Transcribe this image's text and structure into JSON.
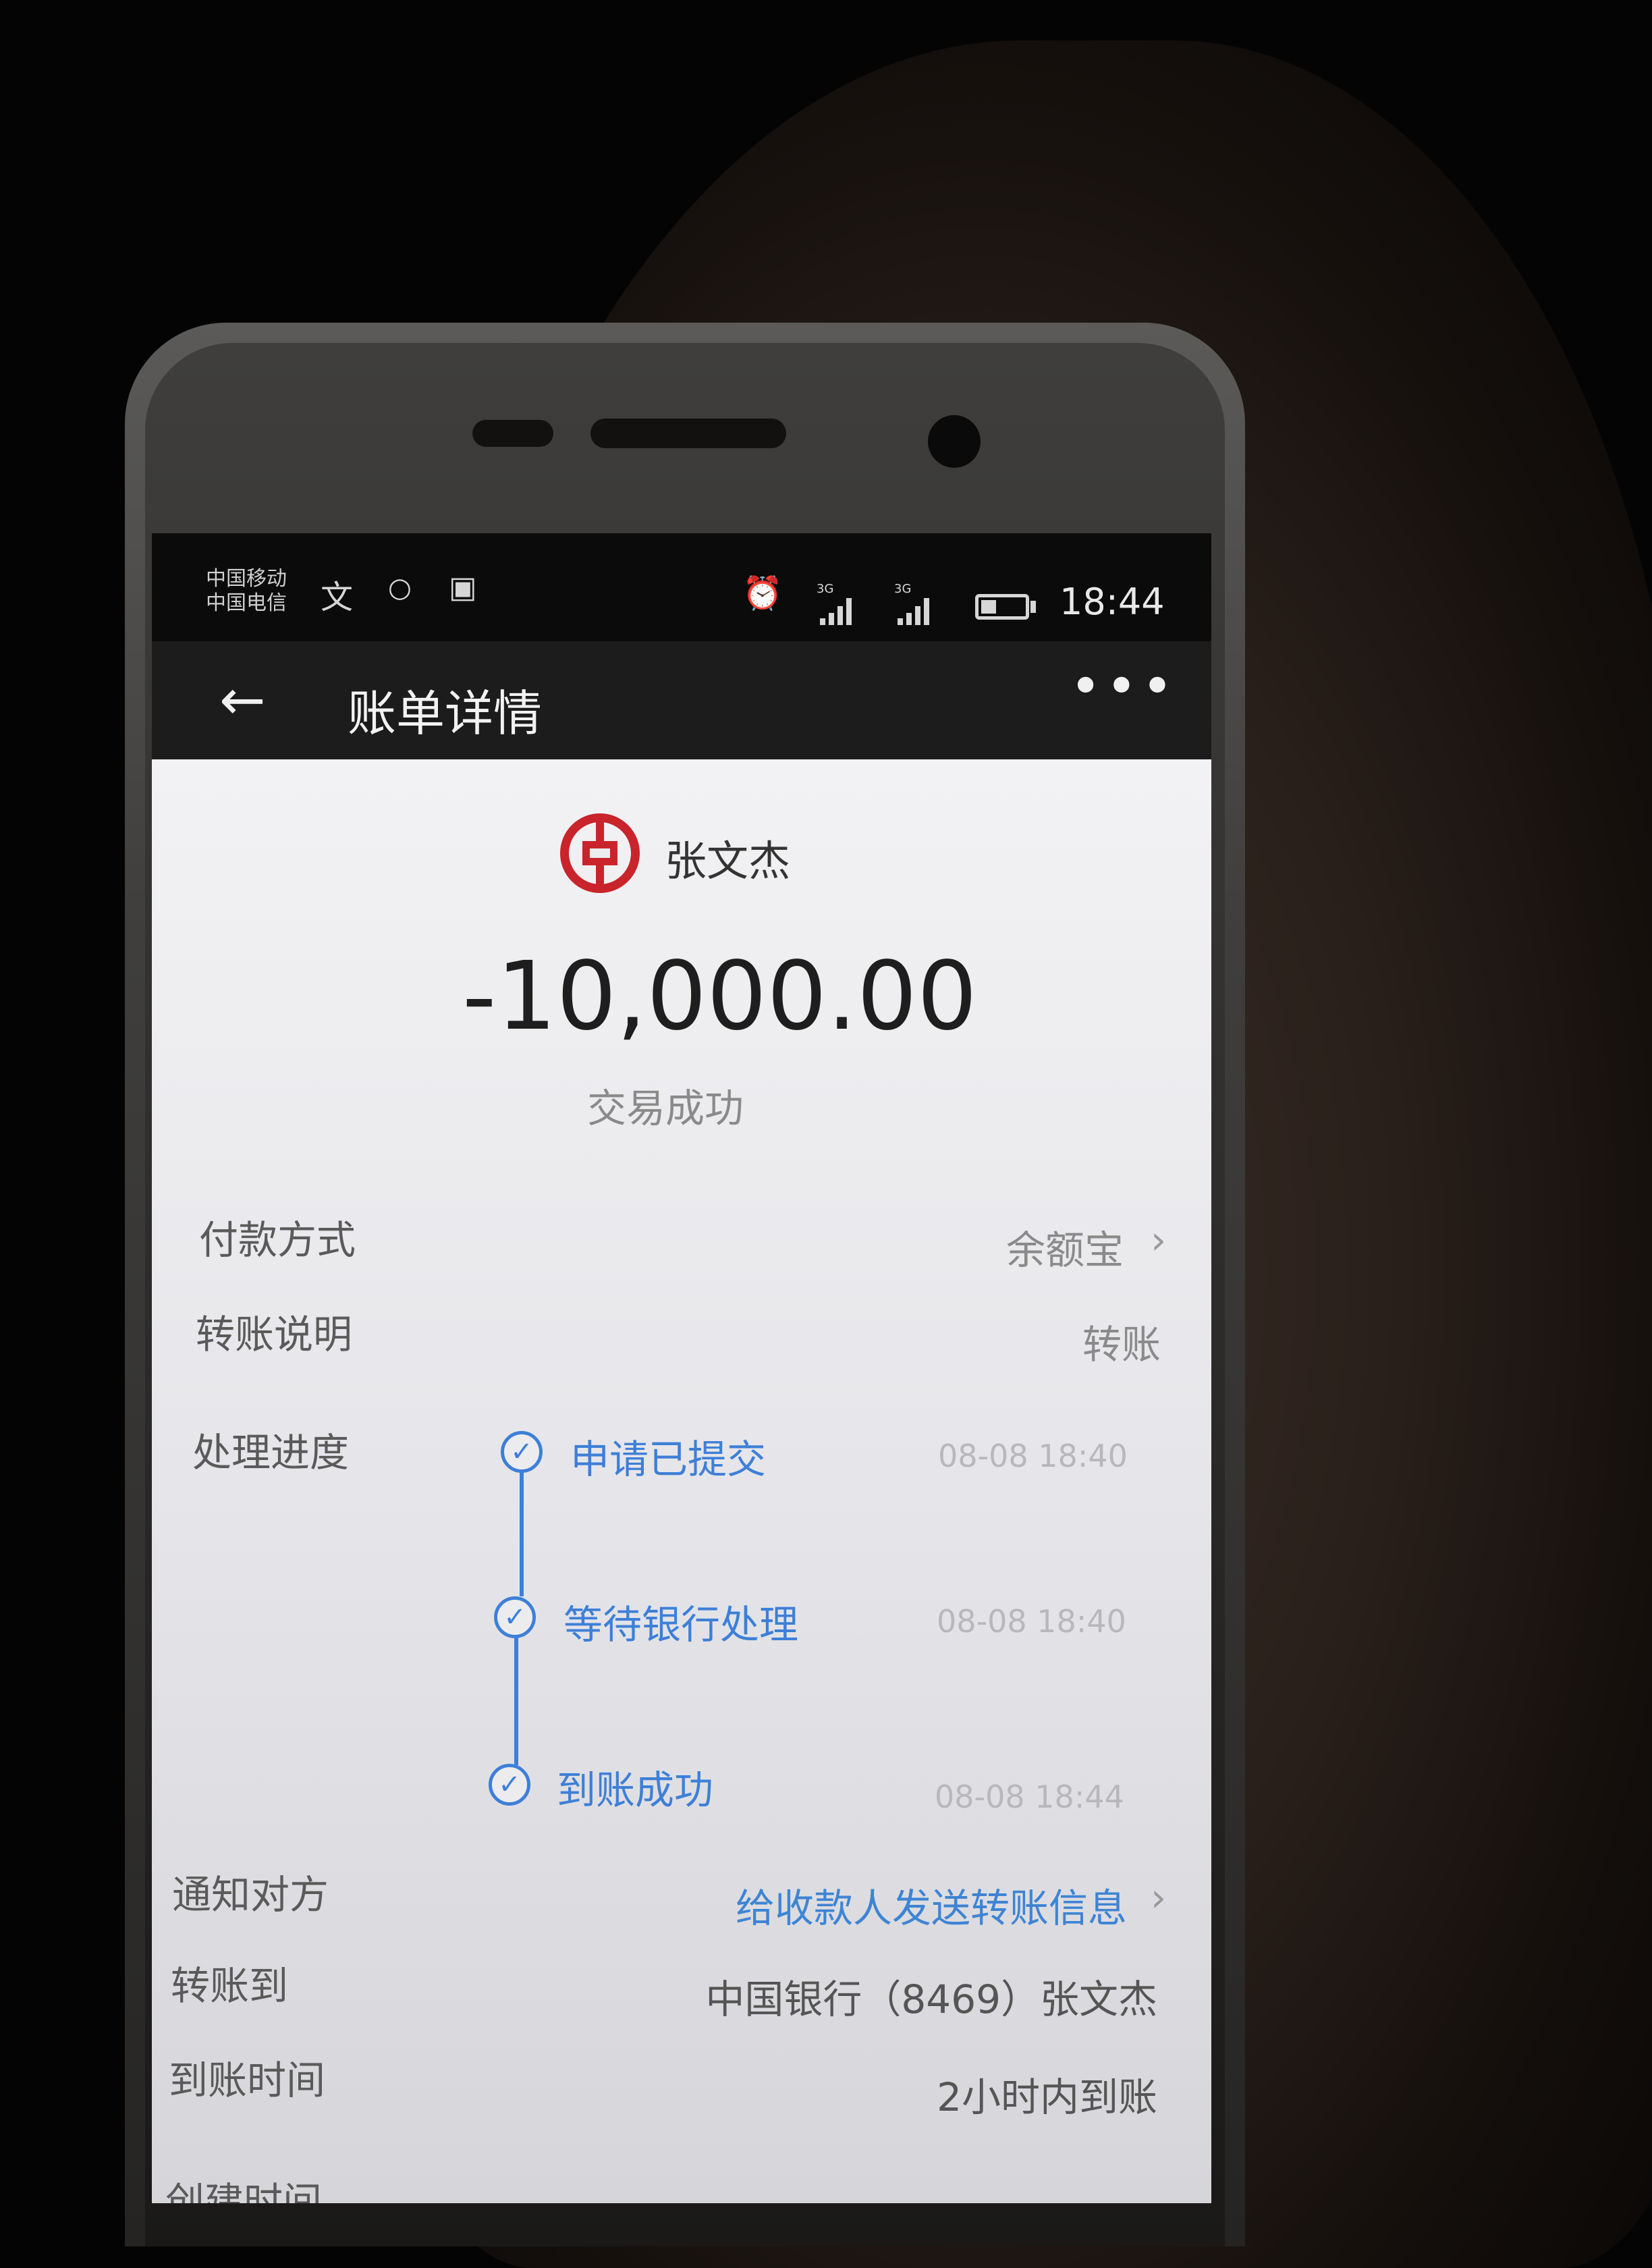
{
  "status_bar": {
    "carrier_1": "中国移动",
    "carrier_2": "中国电信",
    "net_1": "3G",
    "net_2": "3G",
    "time": "18:44",
    "battery_level": 0.35,
    "icons": [
      "translate-icon",
      "chat-icon",
      "image-icon",
      "alarm-icon",
      "signal-icon",
      "signal-icon",
      "battery-icon"
    ]
  },
  "nav": {
    "back_icon": "←",
    "title": "账单详情",
    "more_icon": "•••"
  },
  "header": {
    "bank_logo": "bank-of-china-logo",
    "payee": "张文杰",
    "amount": "-10,000.00",
    "status": "交易成功"
  },
  "details": {
    "payment_method_label": "付款方式",
    "payment_method_value": "余额宝",
    "note_label": "转账说明",
    "note_value": "转账",
    "progress_label": "处理进度",
    "notify_label": "通知对方",
    "notify_value": "给收款人发送转账信息",
    "transfer_to_label": "转账到",
    "transfer_to_value": "中国银行（8469）张文杰",
    "arrival_label": "到账时间",
    "arrival_value": "2小时内到账",
    "created_label": "创建时间"
  },
  "progress": [
    {
      "label": "申请已提交",
      "time": "08-08 18:40"
    },
    {
      "label": "等待银行处理",
      "time": "08-08 18:40"
    },
    {
      "label": "到账成功",
      "time": "08-08 18:44"
    }
  ],
  "colors": {
    "accent_blue": "#3e7fd8",
    "bank_red": "#c9242b"
  }
}
